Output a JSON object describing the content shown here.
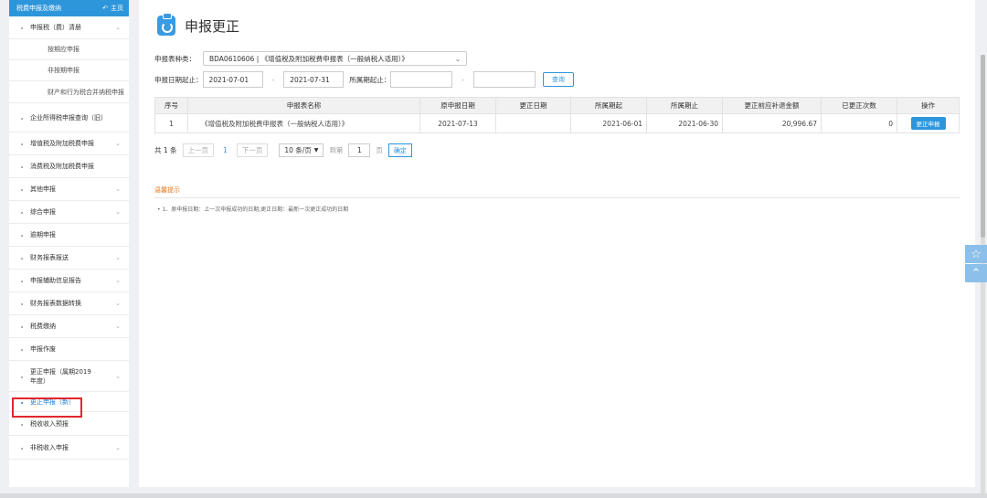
{
  "sidebar": {
    "header": {
      "title": "税费申报及缴纳",
      "home_label": "主页"
    },
    "items": [
      {
        "label": "申报税（费）清册",
        "has_children": true
      },
      {
        "label": "按期应申报",
        "sub": true
      },
      {
        "label": "非按期申报",
        "sub": true
      },
      {
        "label": "财产和行为税合并纳税申报",
        "sub": true
      },
      {
        "label": "企业所得税申报查询（旧）",
        "has_children": false
      },
      {
        "label": "增值税及附加税费申报",
        "has_children": true
      },
      {
        "label": "消费税及附加税费申报",
        "has_children": false
      },
      {
        "label": "其他申报",
        "has_children": true
      },
      {
        "label": "综合申报",
        "has_children": true
      },
      {
        "label": "逾期申报",
        "has_children": false
      },
      {
        "label": "财务报表报送",
        "has_children": true
      },
      {
        "label": "申报辅助信息报告",
        "has_children": true
      },
      {
        "label": "财务报表数据转换",
        "has_children": true
      },
      {
        "label": "税费缴纳",
        "has_children": true
      },
      {
        "label": "申报作废",
        "has_children": false
      },
      {
        "label": "更正申报（属期2019年度）",
        "has_children": true
      },
      {
        "label": "更正申报（新）",
        "has_children": false,
        "active": true
      },
      {
        "label": "税收收入预报",
        "has_children": false
      },
      {
        "label": "非税收入申报",
        "has_children": true
      }
    ]
  },
  "main": {
    "title": "申报更正",
    "filter": {
      "form_type_label": "申报表种类：",
      "form_type_value": "BDA0610606 | 《增值税及附加税费申报表（一般纳税人适用）》",
      "date_label": "申报日期起止：",
      "date_from": "2021-07-01",
      "date_to": "2021-07-31",
      "dash": "-",
      "period_label": "所属期起止：",
      "period_from": "",
      "period_to": "",
      "query_button": "查询"
    },
    "table": {
      "headers": [
        "序号",
        "申报表名称",
        "原申报日期",
        "更正日期",
        "所属期起",
        "所属期止",
        "更正前应补退金额",
        "已更正次数",
        "操作"
      ],
      "rows": [
        {
          "index": "1",
          "name": "《增值税及附加税费申报表（一般纳税人适用）》",
          "orig_date": "2021-07-13",
          "correct_date": "",
          "period_start": "2021-06-01",
          "period_end": "2021-06-30",
          "amount": "20,996.67",
          "count": "0",
          "action": "更正申报"
        }
      ]
    },
    "pager": {
      "total": "共 1 条",
      "prev": "上一页",
      "current": "1",
      "next": "下一页",
      "page_size": "10 条/页",
      "goto_label": "到第",
      "goto_value": "1",
      "page_unit": "页",
      "confirm": "确定"
    },
    "tips": {
      "title": "温馨提示",
      "text": "• 1、原申报日期：上一次申报成功的日期;更正日期：最新一次更正成功的日期"
    }
  },
  "float_buttons": {
    "favorite_icon": "star-icon",
    "top_icon": "chevron-up-icon"
  }
}
